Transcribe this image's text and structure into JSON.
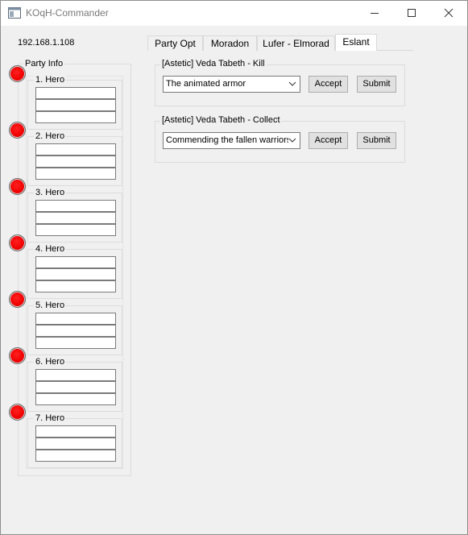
{
  "window": {
    "title": "KOqH-Commander"
  },
  "connection": {
    "ip": "192.168.1.108"
  },
  "tabs": [
    {
      "label": "Party Opt"
    },
    {
      "label": "Moradon"
    },
    {
      "label": "Lufer - Elmorad"
    },
    {
      "label": "Eslant"
    }
  ],
  "active_tab": "Eslant",
  "party": {
    "title": "Party Info",
    "heroes": [
      {
        "label": "1. Hero"
      },
      {
        "label": "2. Hero"
      },
      {
        "label": "3. Hero"
      },
      {
        "label": "4. Hero"
      },
      {
        "label": "5. Hero"
      },
      {
        "label": "6. Hero"
      },
      {
        "label": "7. Hero"
      }
    ],
    "status_color": "#ee0000"
  },
  "quests": [
    {
      "title": "[Astetic] Veda Tabeth - Kill",
      "selected": "The animated armor",
      "accept_label": "Accept",
      "submit_label": "Submit"
    },
    {
      "title": "[Astetic] Veda Tabeth - Collect",
      "selected": "Commending the fallen warriors",
      "accept_label": "Accept",
      "submit_label": "Submit"
    }
  ]
}
